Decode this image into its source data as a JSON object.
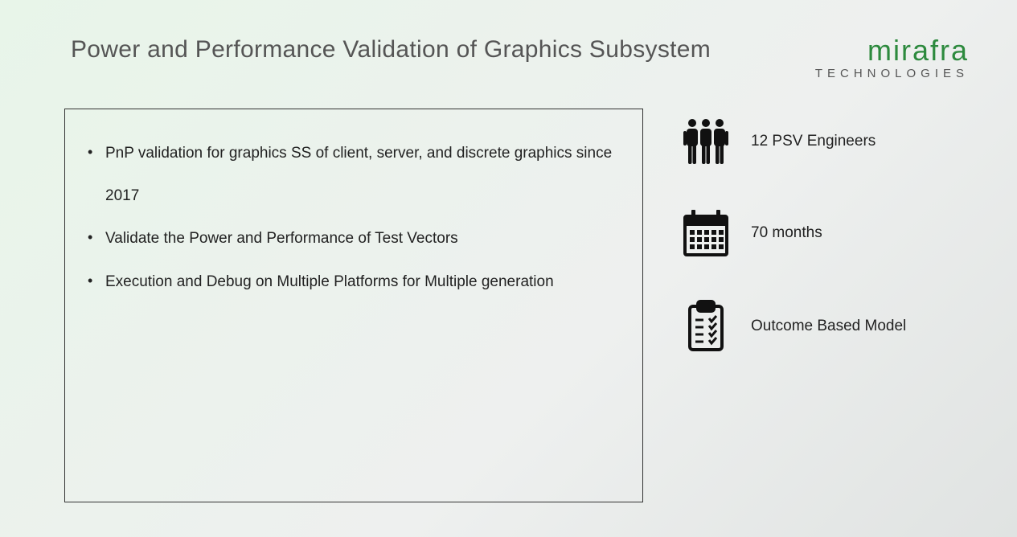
{
  "header": {
    "title": "Power and Performance Validation of Graphics Subsystem"
  },
  "logo": {
    "name": "mirafra",
    "sub": "TECHNOLOGIES"
  },
  "bullets": [
    "PnP validation for graphics SS of client, server, and discrete graphics since 2017",
    "Validate the Power and Performance of Test Vectors",
    "Execution and Debug on Multiple Platforms for Multiple generation"
  ],
  "stats": [
    {
      "icon": "people-icon",
      "label": "12 PSV Engineers"
    },
    {
      "icon": "calendar-icon",
      "label": "70 months"
    },
    {
      "icon": "clipboard-icon",
      "label": "Outcome Based Model"
    }
  ]
}
